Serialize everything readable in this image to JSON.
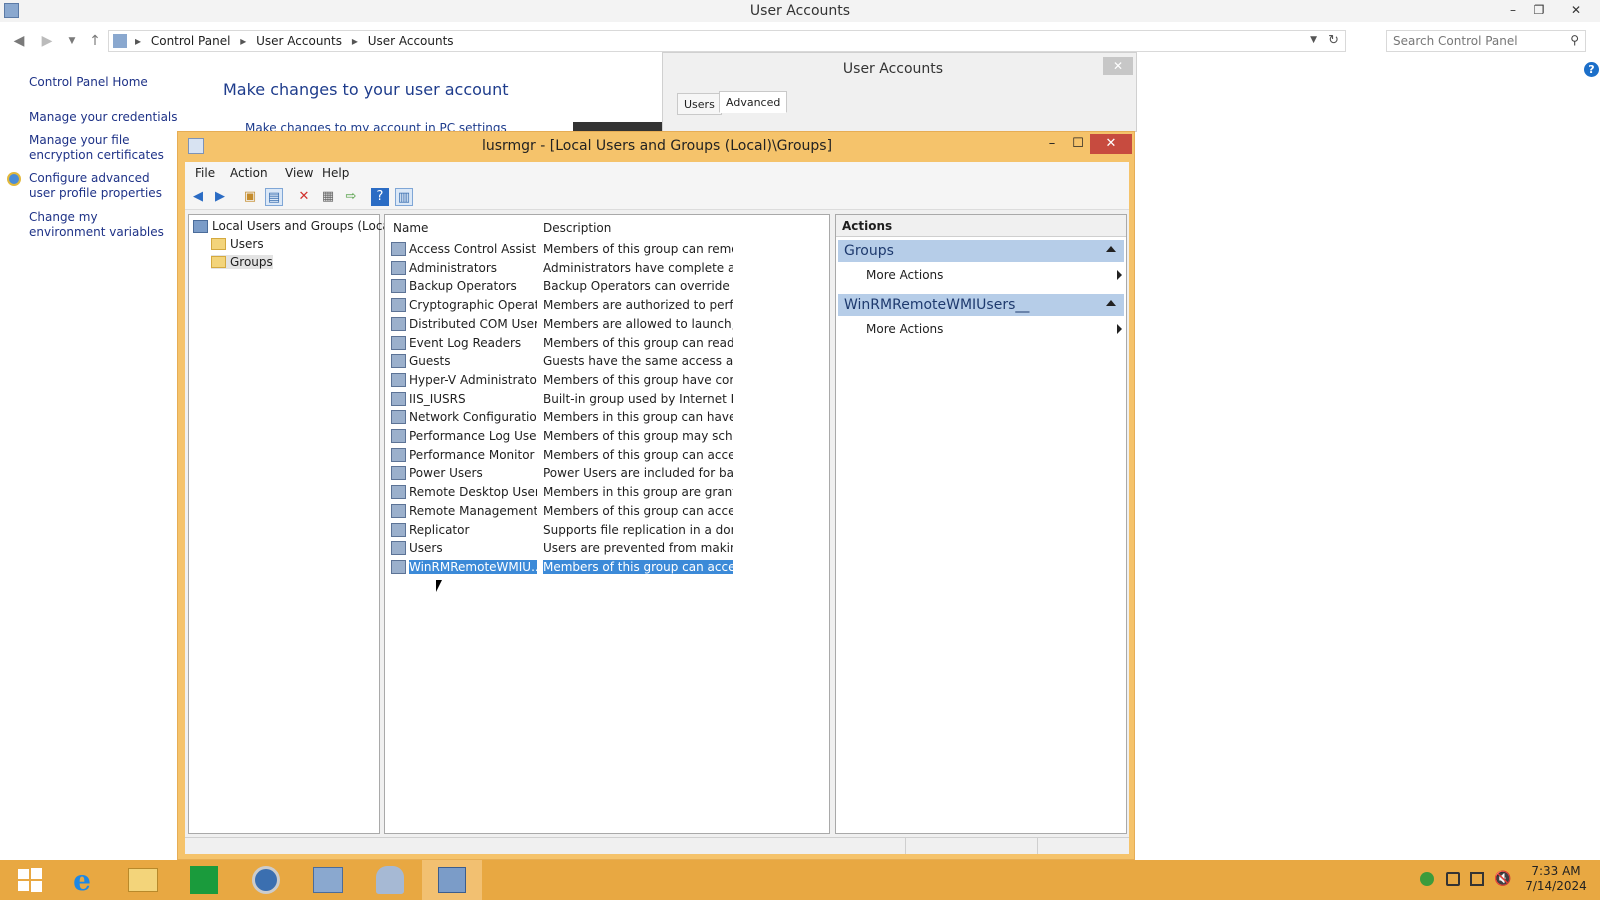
{
  "explorer": {
    "title": "User Accounts",
    "breadcrumbs": [
      "Control Panel",
      "User Accounts",
      "User Accounts"
    ],
    "search_placeholder": "Search Control Panel"
  },
  "left_nav": {
    "home": "Control Panel Home",
    "items": [
      "Manage your credentials",
      "Manage your file encryption certificates",
      "Configure advanced user profile properties",
      "Change my environment variables"
    ]
  },
  "content": {
    "heading": "Make changes to your user account",
    "subtitle": "Make changes to my account in PC settings"
  },
  "dialog": {
    "title": "User Accounts",
    "tabs": [
      "Users",
      "Advanced"
    ]
  },
  "mmc": {
    "title": "lusrmgr - [Local Users and Groups (Local)\\Groups]",
    "menu": [
      "File",
      "Action",
      "View",
      "Help"
    ],
    "tree": {
      "root": "Local Users and Groups (Local)",
      "children": [
        "Users",
        "Groups"
      ]
    },
    "columns": [
      "Name",
      "Description"
    ],
    "rows": [
      {
        "name": "Access Control Assist...",
        "desc": "Members of this group can remot..."
      },
      {
        "name": "Administrators",
        "desc": "Administrators have complete an..."
      },
      {
        "name": "Backup Operators",
        "desc": "Backup Operators can override se..."
      },
      {
        "name": "Cryptographic Operat...",
        "desc": "Members are authorized to perfor..."
      },
      {
        "name": "Distributed COM Users",
        "desc": "Members are allowed to launch, a..."
      },
      {
        "name": "Event Log Readers",
        "desc": "Members of this group can read e..."
      },
      {
        "name": "Guests",
        "desc": "Guests have the same access as m..."
      },
      {
        "name": "Hyper-V Administrators",
        "desc": "Members of this group have com..."
      },
      {
        "name": "IIS_IUSRS",
        "desc": "Built-in group used by Internet Inf..."
      },
      {
        "name": "Network Configuratio...",
        "desc": "Members in this group can have s..."
      },
      {
        "name": "Performance Log Users",
        "desc": "Members of this group may sche..."
      },
      {
        "name": "Performance Monitor ...",
        "desc": "Members of this group can acces..."
      },
      {
        "name": "Power Users",
        "desc": "Power Users are included for back..."
      },
      {
        "name": "Remote Desktop Users",
        "desc": "Members in this group are grante..."
      },
      {
        "name": "Remote Management...",
        "desc": "Members of this group can acces..."
      },
      {
        "name": "Replicator",
        "desc": "Supports file replication in a dom..."
      },
      {
        "name": "Users",
        "desc": "Users are prevented from making ..."
      },
      {
        "name": "WinRMRemoteWMIU...",
        "desc": "Members of this group can acces..."
      }
    ],
    "actions": {
      "header": "Actions",
      "sections": [
        {
          "title": "Groups",
          "item": "More Actions"
        },
        {
          "title": "WinRMRemoteWMIUsers__",
          "item": "More Actions"
        }
      ]
    }
  },
  "taskbar": {
    "time": "7:33 AM",
    "date": "7/14/2024"
  },
  "colors": {
    "accent": "#e8a842",
    "selection": "#3c8ad8",
    "close": "#c74b3f"
  }
}
